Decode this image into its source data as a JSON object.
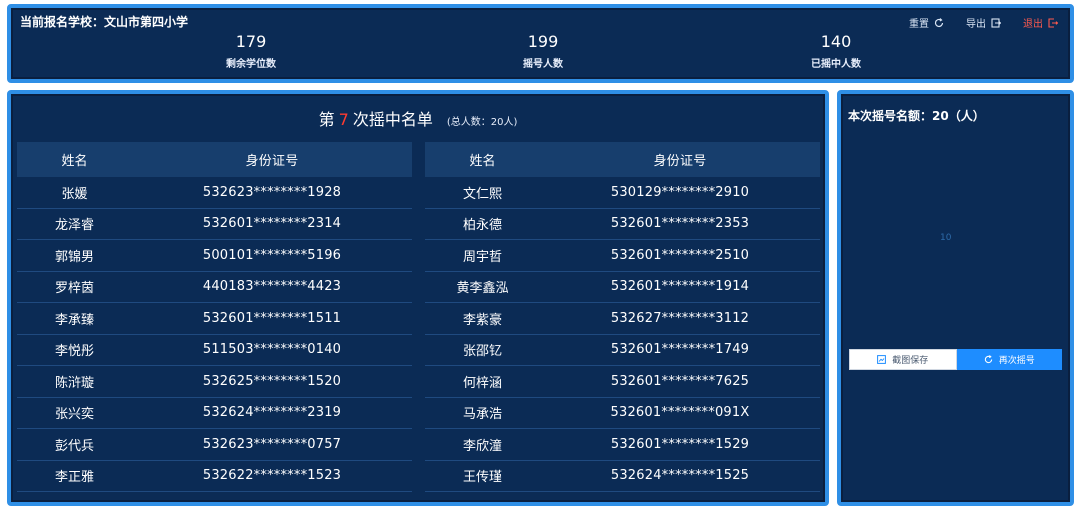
{
  "header": {
    "school_label": "当前报名学校：文山市第四小学",
    "reset_label": "重置",
    "export_label": "导出",
    "exit_label": "退出"
  },
  "stats": [
    {
      "value": "179",
      "label": "剩余学位数"
    },
    {
      "value": "199",
      "label": "摇号人数"
    },
    {
      "value": "140",
      "label": "已摇中人数"
    }
  ],
  "list": {
    "title_prefix": "第",
    "round": "7",
    "title_suffix": "次摇中名单",
    "total_text": "(总人数：20人)",
    "col_name": "姓名",
    "col_id": "身份证号",
    "left": [
      {
        "name": "张媛",
        "id": "532623********1928"
      },
      {
        "name": "龙泽睿",
        "id": "532601********2314"
      },
      {
        "name": "郭锦男",
        "id": "500101********5196"
      },
      {
        "name": "罗梓茵",
        "id": "440183********4423"
      },
      {
        "name": "李承臻",
        "id": "532601********1511"
      },
      {
        "name": "李悦彤",
        "id": "511503********0140"
      },
      {
        "name": "陈浒璇",
        "id": "532625********1520"
      },
      {
        "name": "张兴奕",
        "id": "532624********2319"
      },
      {
        "name": "彭代兵",
        "id": "532623********0757"
      },
      {
        "name": "李正雅",
        "id": "532622********1523"
      }
    ],
    "right": [
      {
        "name": "文仁熙",
        "id": "530129********2910"
      },
      {
        "name": "柏永德",
        "id": "532601********2353"
      },
      {
        "name": "周宇哲",
        "id": "532601********2510"
      },
      {
        "name": "黄李鑫泓",
        "id": "532601********1914"
      },
      {
        "name": "李紫豪",
        "id": "532627********3112"
      },
      {
        "name": "张邵钇",
        "id": "532601********1749"
      },
      {
        "name": "何梓涵",
        "id": "532601********7625"
      },
      {
        "name": "马承浩",
        "id": "532601********091X"
      },
      {
        "name": "李欣潼",
        "id": "532601********1529"
      },
      {
        "name": "王传瑾",
        "id": "532624********1525"
      }
    ]
  },
  "side": {
    "quota_label": "本次摇号名额：20（人）",
    "spinner_text": "10",
    "save_label": "截图保存",
    "redraw_label": "再次摇号"
  },
  "colors": {
    "panel_bg": "#0b2b55",
    "panel_border": "#2f8fe6",
    "accent_red": "#ff3b30",
    "button_blue": "#1e8dff"
  },
  "icons": {
    "reset": "refresh-icon",
    "export": "export-icon",
    "exit": "logout-icon",
    "save": "image-save-icon",
    "redraw": "refresh-icon"
  }
}
